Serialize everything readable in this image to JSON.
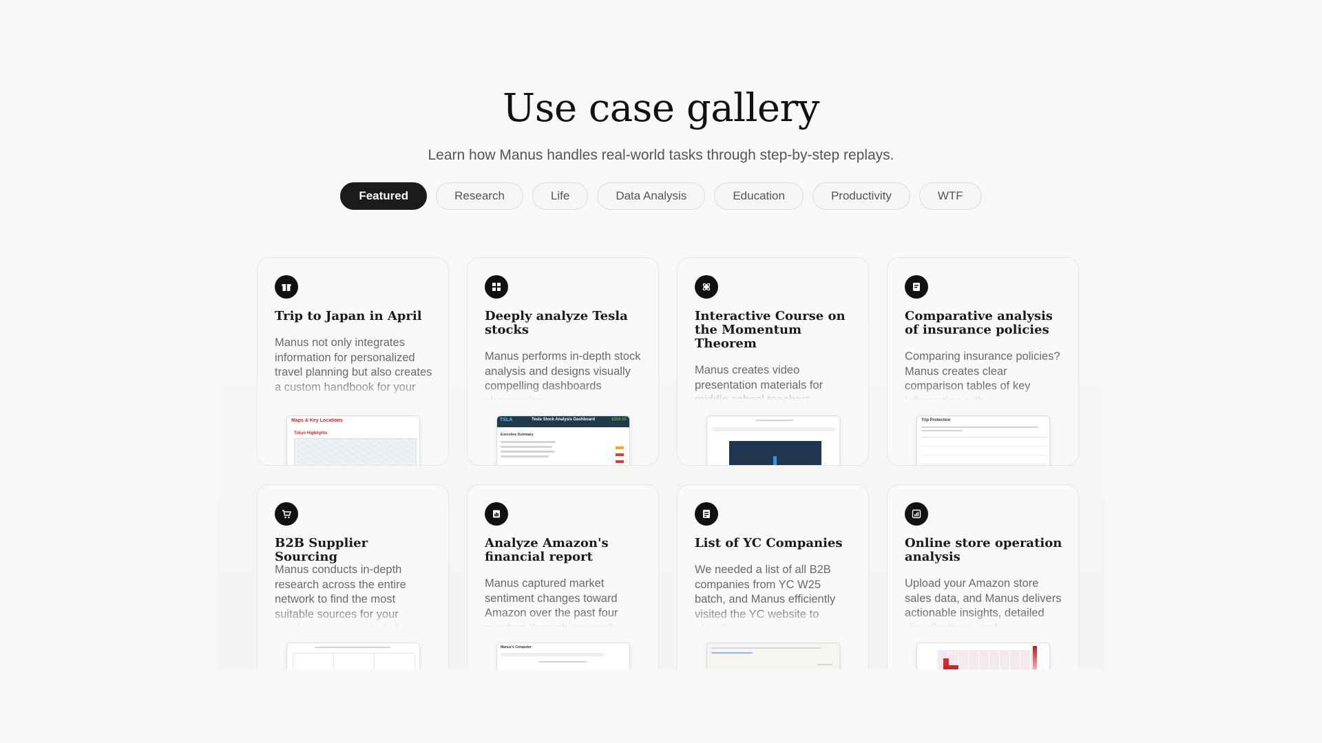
{
  "hero": {
    "title": "Use case gallery",
    "subtitle": "Learn how Manus handles real-world tasks through step-by-step replays."
  },
  "tabs": [
    {
      "label": "Featured",
      "active": true
    },
    {
      "label": "Research",
      "active": false
    },
    {
      "label": "Life",
      "active": false
    },
    {
      "label": "Data Analysis",
      "active": false
    },
    {
      "label": "Education",
      "active": false
    },
    {
      "label": "Productivity",
      "active": false
    },
    {
      "label": "WTF",
      "active": false
    }
  ],
  "cards": [
    {
      "icon": "gift-icon",
      "title": "Trip to Japan in April",
      "description": "Manus not only integrates information for personalized travel planning but also creates a custom handbook for your",
      "preview": {
        "heading": "Maps & Key Locations",
        "subheading": "Tokyo Highlights"
      }
    },
    {
      "icon": "chart-icon",
      "title": "Deeply analyze Tesla stocks",
      "description": "Manus performs in-depth stock analysis and designs visually compelling dashboards showcasing",
      "preview": {
        "ticker": "TSLA",
        "heading": "Tesla Stock Analysis Dashboard",
        "price": "$284.95",
        "section": "Executive Summary"
      }
    },
    {
      "icon": "atom-icon",
      "title": "Interactive Course on the Momentum Theorem",
      "description": "Manus creates video presentation materials for middle school teachers",
      "preview": {}
    },
    {
      "icon": "document-icon",
      "title": "Comparative analysis of insurance policies",
      "description": "Comparing insurance policies? Manus creates clear comparison tables of key information with",
      "preview": {
        "heading": "Trip Protection"
      }
    },
    {
      "icon": "cart-icon",
      "title": "B2B Supplier Sourcing",
      "description": "Manus conducts in-depth research across the entire network to find the most suitable sources for your needs. manus is a truly fair",
      "preview": {}
    },
    {
      "icon": "report-icon",
      "title": "Analyze Amazon's financial report",
      "description": "Manus captured market sentiment changes toward Amazon over the past four quarters through research",
      "preview": {
        "heading": "Manus's Computer"
      }
    },
    {
      "icon": "list-icon",
      "title": "List of YC Companies",
      "description": "We needed a list of all B2B companies from YC W25 batch, and Manus efficiently visited the YC website to identify",
      "preview": {}
    },
    {
      "icon": "bar-chart-icon",
      "title": "Online store operation analysis",
      "description": "Upload your Amazon store sales data, and Manus delivers actionable insights, detailed visualizations, and",
      "preview": {}
    }
  ]
}
